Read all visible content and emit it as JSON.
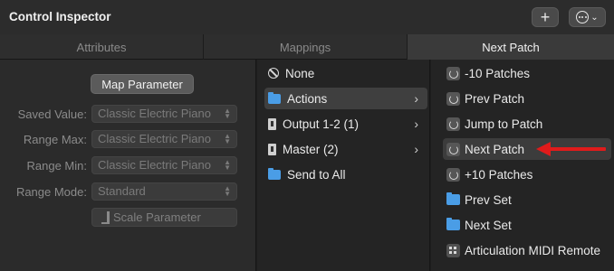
{
  "window": {
    "title": "Control Inspector"
  },
  "toolbar": {
    "add_icon": "plus-icon",
    "more_icon": "ellipsis-circle-icon",
    "chevron": "⌄"
  },
  "tabs": [
    {
      "label": "Attributes",
      "active": false
    },
    {
      "label": "Mappings",
      "active": false
    },
    {
      "label": "Next Patch",
      "active": true
    }
  ],
  "left": {
    "map_button": "Map Parameter",
    "fields": [
      {
        "label": "Saved Value:",
        "value": "Classic Electric Piano"
      },
      {
        "label": "Range Max:",
        "value": "Classic Electric Piano"
      },
      {
        "label": "Range Min:",
        "value": "Classic Electric Piano"
      },
      {
        "label": "Range Mode:",
        "value": "Standard"
      }
    ],
    "scale_button": "Scale Parameter"
  },
  "middle": {
    "items": [
      {
        "label": "None",
        "icon": "none-icon",
        "has_children": false,
        "selected": false
      },
      {
        "label": "Actions",
        "icon": "folder-icon",
        "has_children": true,
        "selected": true
      },
      {
        "label": "Output 1-2 (1)",
        "icon": "channel-strip-icon",
        "has_children": true,
        "selected": false
      },
      {
        "label": "Master (2)",
        "icon": "channel-strip-icon",
        "has_children": true,
        "selected": false
      },
      {
        "label": "Send to All",
        "icon": "folder-icon",
        "has_children": false,
        "selected": false
      }
    ],
    "chevron": "›"
  },
  "right": {
    "items": [
      {
        "label": "-10 Patches",
        "icon": "action-icon",
        "selected": false
      },
      {
        "label": "Prev Patch",
        "icon": "action-icon",
        "selected": false
      },
      {
        "label": "Jump to Patch",
        "icon": "action-icon",
        "selected": false
      },
      {
        "label": "Next Patch",
        "icon": "action-icon",
        "selected": true
      },
      {
        "label": "+10 Patches",
        "icon": "action-icon",
        "selected": false
      },
      {
        "label": "Prev Set",
        "icon": "set-folder-icon",
        "selected": false
      },
      {
        "label": "Next Set",
        "icon": "set-folder-icon",
        "selected": false
      },
      {
        "label": "Articulation MIDI Remote",
        "icon": "midi-remote-icon",
        "selected": false
      }
    ]
  },
  "annotation": {
    "color": "#e01b1b",
    "points_to": "Next Patch"
  }
}
